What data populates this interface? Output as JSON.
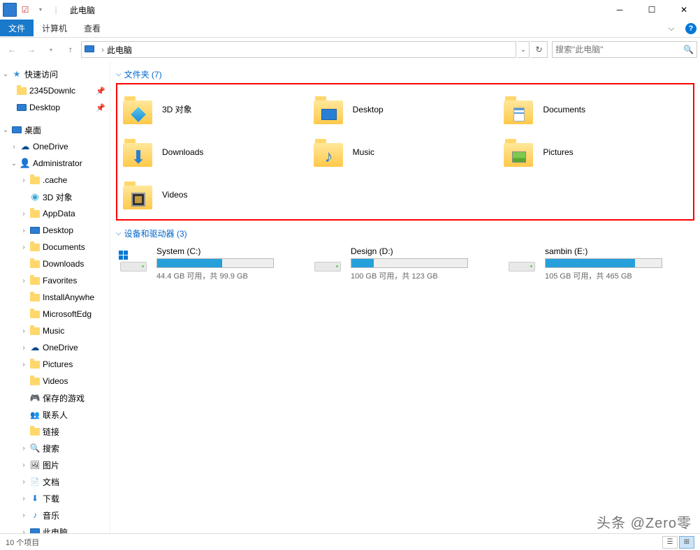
{
  "window": {
    "title": "此电脑"
  },
  "ribbon": {
    "file": "文件",
    "computer": "计算机",
    "view": "查看"
  },
  "nav": {
    "location": "此电脑",
    "search_placeholder": "搜索\"此电脑\""
  },
  "sidebar": {
    "quick": {
      "label": "快速访问",
      "items": [
        {
          "label": "2345Downlc",
          "pinned": true
        },
        {
          "label": "Desktop",
          "pinned": true
        }
      ]
    },
    "desktop": {
      "label": "桌面",
      "items": [
        {
          "label": "OneDrive",
          "icon": "cloud",
          "expandable": true
        },
        {
          "label": "Administrator",
          "icon": "user",
          "expandable": true,
          "expanded": true,
          "children": [
            {
              "label": ".cache",
              "icon": "folder",
              "expandable": true
            },
            {
              "label": "3D 对象",
              "icon": "3d"
            },
            {
              "label": "AppData",
              "icon": "folder",
              "expandable": true
            },
            {
              "label": "Desktop",
              "icon": "monitor",
              "expandable": true
            },
            {
              "label": "Documents",
              "icon": "folder",
              "expandable": true
            },
            {
              "label": "Downloads",
              "icon": "folder"
            },
            {
              "label": "Favorites",
              "icon": "folder",
              "expandable": true
            },
            {
              "label": "InstallAnywhe",
              "icon": "folder"
            },
            {
              "label": "MicrosoftEdg",
              "icon": "folder"
            },
            {
              "label": "Music",
              "icon": "folder",
              "expandable": true
            },
            {
              "label": "OneDrive",
              "icon": "cloud",
              "expandable": true
            },
            {
              "label": "Pictures",
              "icon": "folder",
              "expandable": true
            },
            {
              "label": "Videos",
              "icon": "folder"
            },
            {
              "label": "保存的游戏",
              "icon": "games"
            },
            {
              "label": "联系人",
              "icon": "contacts"
            },
            {
              "label": "链接",
              "icon": "folder"
            },
            {
              "label": "搜索",
              "icon": "search",
              "expandable": true
            },
            {
              "label": "图片",
              "icon": "pictures",
              "expandable": true
            },
            {
              "label": "文档",
              "icon": "docs",
              "expandable": true
            },
            {
              "label": "下载",
              "icon": "download",
              "expandable": true
            },
            {
              "label": "音乐",
              "icon": "music",
              "expandable": true
            },
            {
              "label": "此电脑",
              "icon": "monitor",
              "expandable": true
            }
          ]
        }
      ]
    }
  },
  "content": {
    "folders_header": "文件夹 (7)",
    "folders": [
      {
        "label": "3D 对象",
        "overlay": "3d"
      },
      {
        "label": "Desktop",
        "overlay": "desktop"
      },
      {
        "label": "Documents",
        "overlay": "docs"
      },
      {
        "label": "Downloads",
        "overlay": "download"
      },
      {
        "label": "Music",
        "overlay": "music"
      },
      {
        "label": "Pictures",
        "overlay": "pictures"
      },
      {
        "label": "Videos",
        "overlay": "videos"
      }
    ],
    "drives_header": "设备和驱动器 (3)",
    "drives": [
      {
        "label": "System (C:)",
        "stats": "44.4 GB 可用，共 99.9 GB",
        "fill": 56,
        "system": true
      },
      {
        "label": "Design (D:)",
        "stats": "100 GB 可用，共 123 GB",
        "fill": 19
      },
      {
        "label": "sambin (E:)",
        "stats": "105 GB 可用，共 465 GB",
        "fill": 77
      }
    ]
  },
  "statusbar": {
    "items": "10 个项目"
  },
  "watermark": "头条 @Zero零"
}
